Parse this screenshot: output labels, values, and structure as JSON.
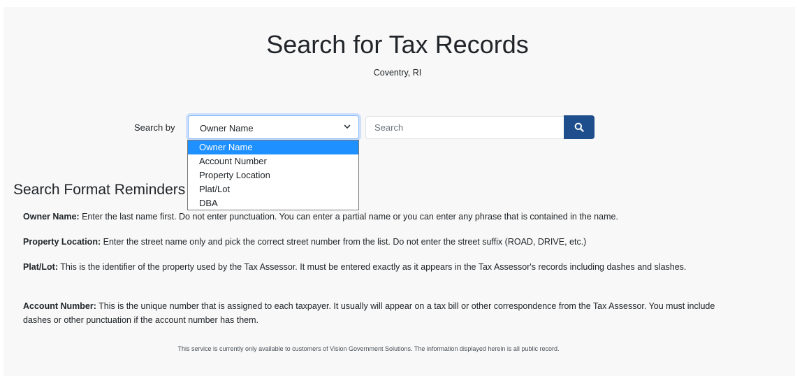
{
  "header": {
    "title": "Search for Tax Records",
    "subtitle": "Coventry, RI"
  },
  "search": {
    "label": "Search by",
    "selected": "Owner Name",
    "options": [
      "Owner Name",
      "Account Number",
      "Property Location",
      "Plat/Lot",
      "DBA"
    ],
    "placeholder": "Search",
    "value": "",
    "button_icon": "search-icon"
  },
  "reminders": {
    "heading": "Search Format Reminders",
    "items": [
      {
        "term": "Owner Name:",
        "text": "Enter the last name first. Do not enter punctuation. You can enter a partial name or you can enter any phrase that is contained in the name."
      },
      {
        "term": "Property Location:",
        "text": "Enter the street name only and pick the correct street number from the list. Do not enter the street suffix (ROAD, DRIVE, etc.)"
      },
      {
        "term": "Plat/Lot:",
        "text": "This is the identifier of the property used by the Tax Assessor. It must be entered exactly as it appears in the Tax Assessor's records including dashes and slashes."
      },
      {
        "term": "Account Number:",
        "text": "This is the unique number that is assigned to each taxpayer. It usually will appear on a tax bill or other correspondence from the Tax Assessor. You must include dashes or other punctuation if the account number has them."
      }
    ]
  },
  "footer": {
    "text": "This service is currently only available to customers of Vision Government Solutions. The information displayed herein is all public record."
  },
  "colors": {
    "accent": "#1f4e8c",
    "highlight": "#1e90ff",
    "page_bg": "#f8f8f8"
  }
}
